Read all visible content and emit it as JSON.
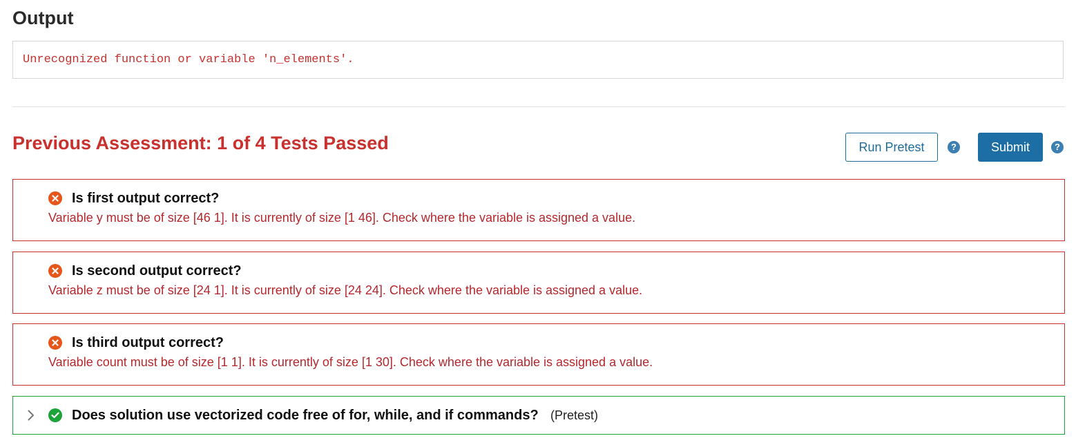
{
  "output": {
    "heading": "Output",
    "text": "Unrecognized function or variable 'n_elements'."
  },
  "assessment": {
    "title": "Previous Assessment: 1 of 4 Tests Passed",
    "run_pretest_label": "Run Pretest",
    "submit_label": "Submit",
    "help_icon_glyph": "?"
  },
  "tests": [
    {
      "status": "failed",
      "icon": "x-circle-icon",
      "title": "Is first output correct?",
      "message": "Variable y must be of size [46 1]. It is currently of size [1 46]. Check where the variable is assigned a value."
    },
    {
      "status": "failed",
      "icon": "x-circle-icon",
      "title": "Is second output correct?",
      "message": "Variable z must be of size [24 1]. It is currently of size [24 24]. Check where the variable is assigned a value."
    },
    {
      "status": "failed",
      "icon": "x-circle-icon",
      "title": "Is third output correct?",
      "message": "Variable count must be of size [1 1]. It is currently of size [1 30]. Check where the variable is assigned a value."
    },
    {
      "status": "passed",
      "icon": "check-circle-icon",
      "title": "Does solution use vectorized code free of for, while, and if commands?",
      "tag": "(Pretest)"
    }
  ],
  "colors": {
    "error_red": "#c8312d",
    "fail_icon": "#e6561b",
    "pass_green": "#1ca33a",
    "primary_blue": "#1c6ea4"
  }
}
